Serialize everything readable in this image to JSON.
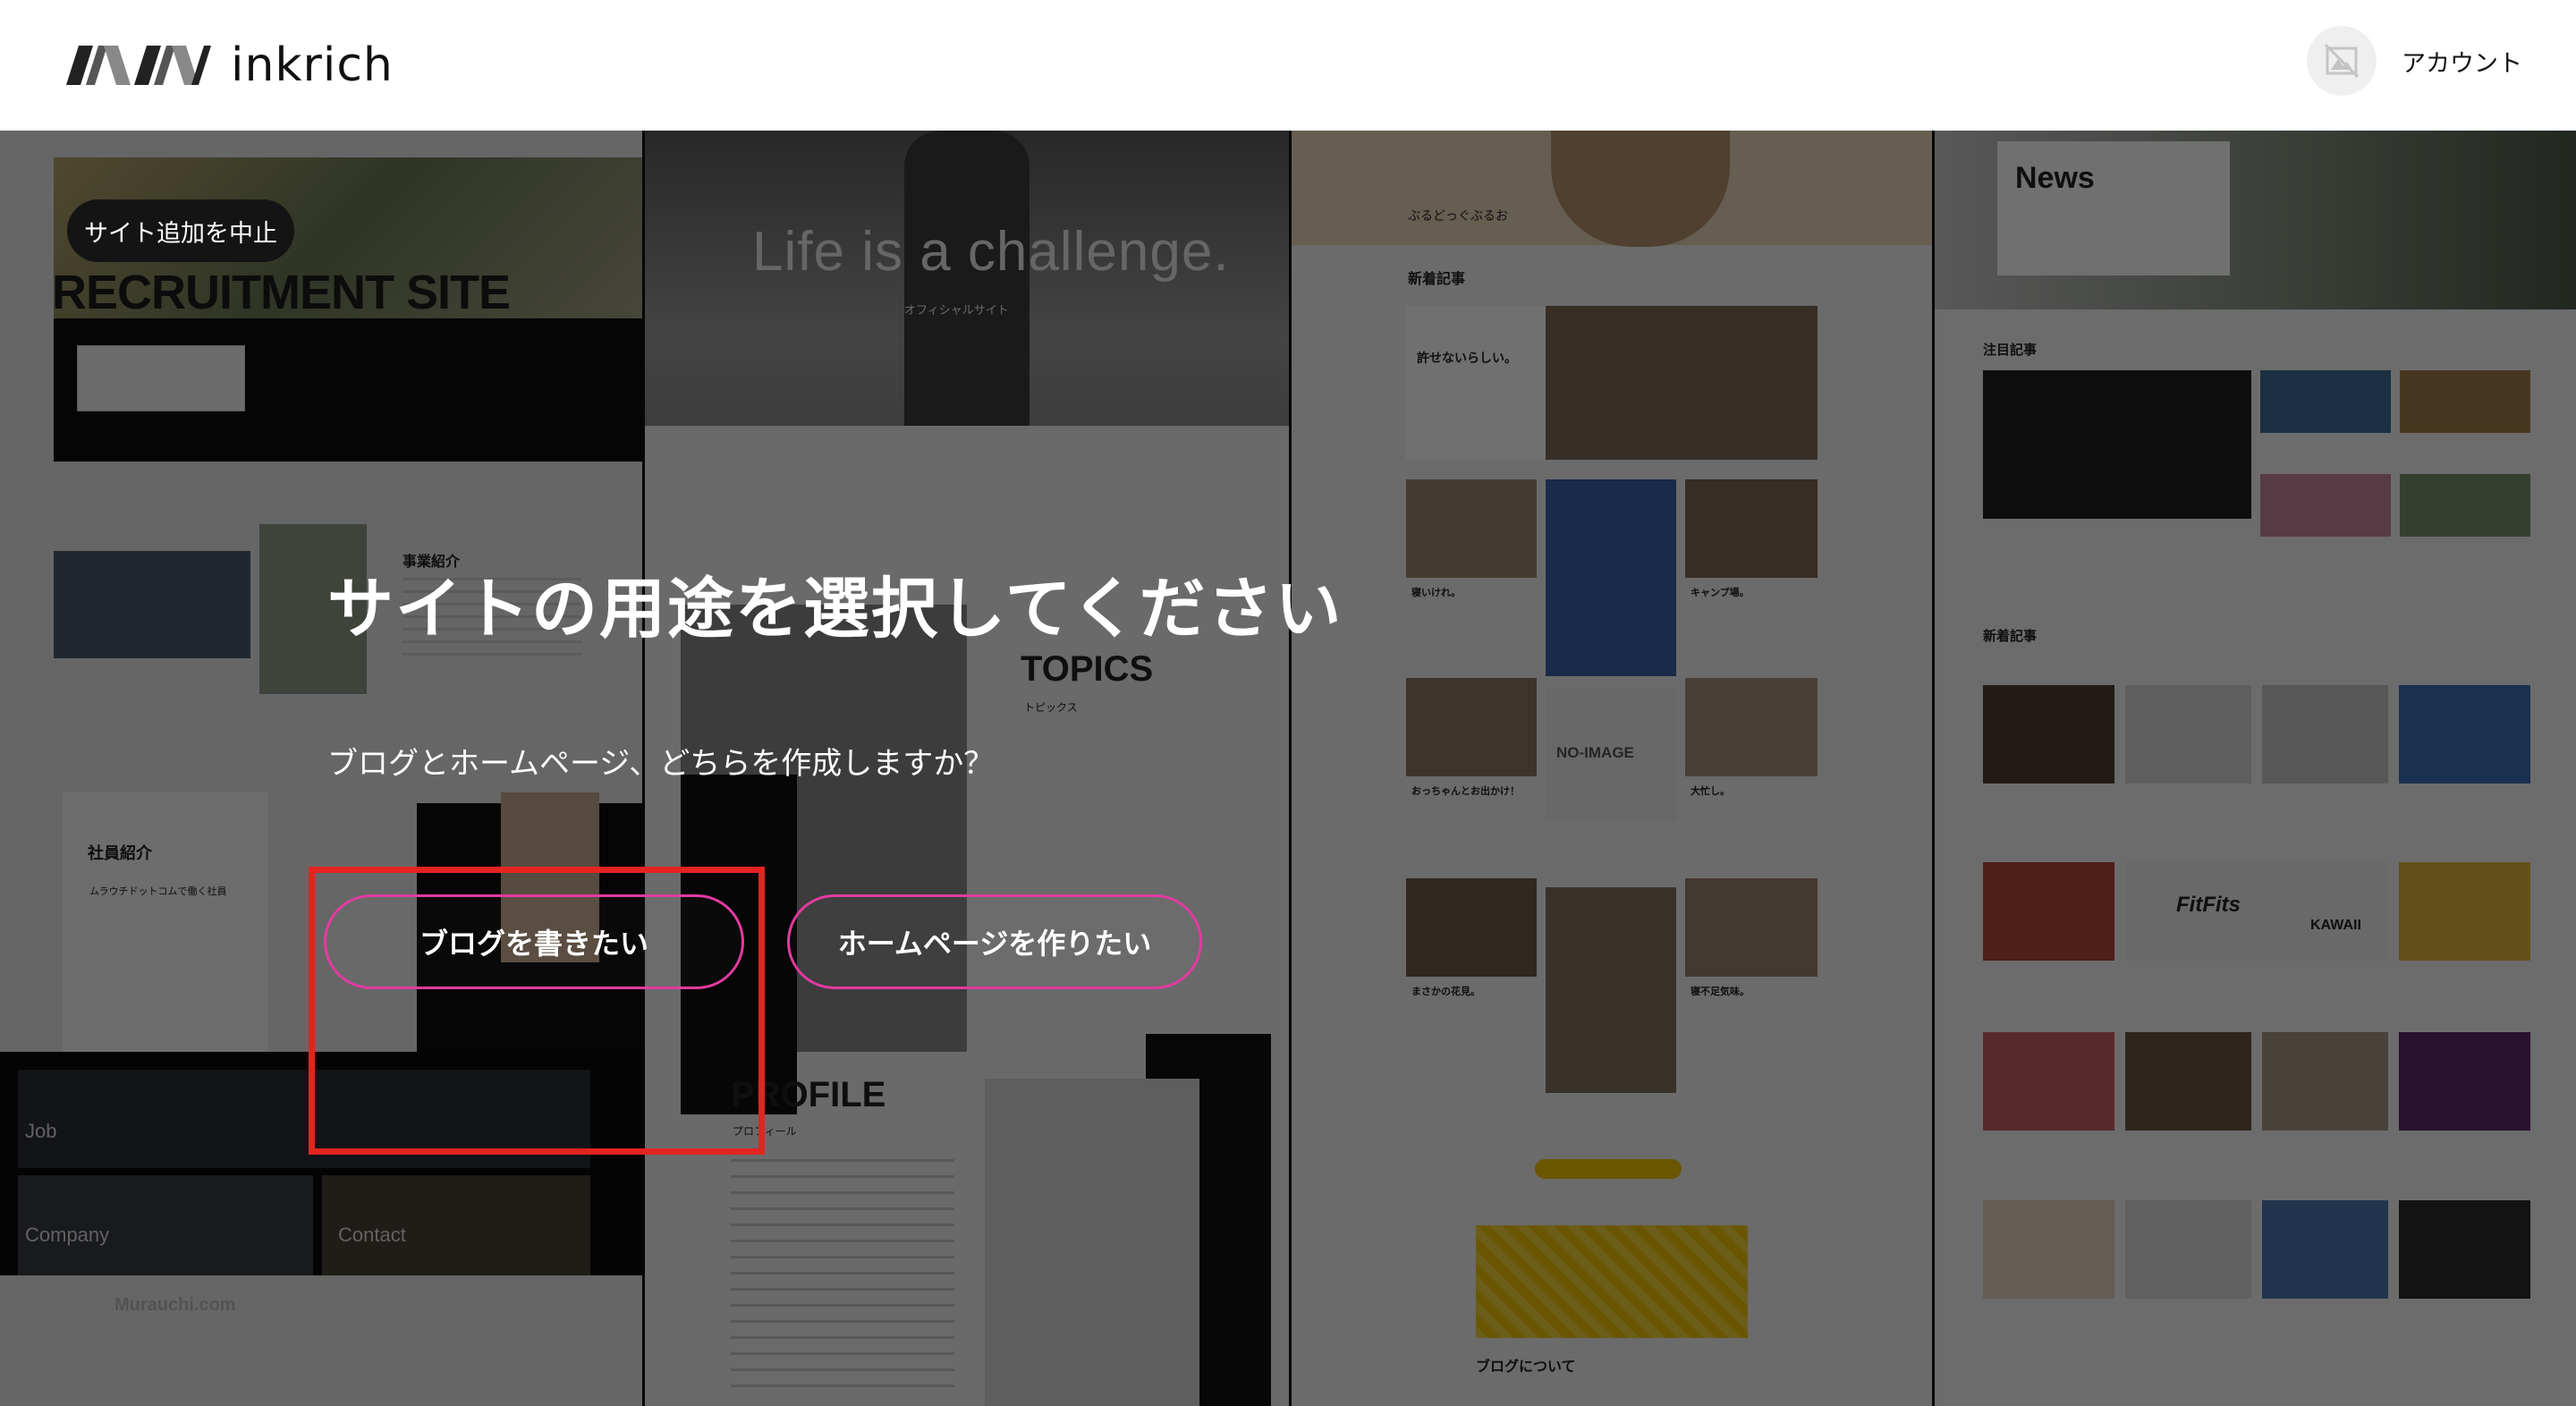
{
  "header": {
    "brand_name": "inkrich",
    "account_label": "アカウント"
  },
  "actions": {
    "cancel_label": "サイト追加を中止"
  },
  "dialog": {
    "title": "サイトの用途を選択してください",
    "subtitle": "ブログとホームページ、どちらを作成しますか？",
    "blog_button_label": "ブログを書きたい",
    "homepage_button_label": "ホームページを作りたい"
  },
  "templates": {
    "recruit": {
      "hero_title": "RECRUITMENT SITE",
      "business_label": "事業紹介",
      "staff_label": "社員紹介",
      "staff_sub": "ムラウチドットコムで働く社員",
      "job_label": "Job",
      "company_label": "Company",
      "contact_label": "Contact",
      "footer_brand": "Murauchi.com"
    },
    "athlete": {
      "hero_title": "Life is a challenge.",
      "hero_sub": "オフィシャルサイト",
      "topics_label": "TOPICS",
      "topics_sub": "トピックス",
      "profile_label": "PROFILE",
      "profile_sub": "プロフィール"
    },
    "pet_blog": {
      "brand": "ぶるどっぐぶるお",
      "new_posts_label": "新着記事",
      "post1": "許せないらしい。",
      "post2": "寝いけれ。",
      "post3": "キャンプ場。",
      "noimage_label": "NO-IMAGE",
      "post4": "おっちゃんとお出かけ！",
      "post5": "大忙し。",
      "post6": "まさかの花見。",
      "post7": "寝不足気味。",
      "about_label": "ブログについて"
    },
    "media": {
      "news_label": "News",
      "featured_label": "注目記事",
      "new_posts_label": "新着記事",
      "promo_brand": "FitFits",
      "promo_brand2": "KAWAII"
    }
  },
  "colors": {
    "accent_pink": "#e23aa0",
    "highlight_red": "#e5231f",
    "header_bg": "#ffffff"
  }
}
